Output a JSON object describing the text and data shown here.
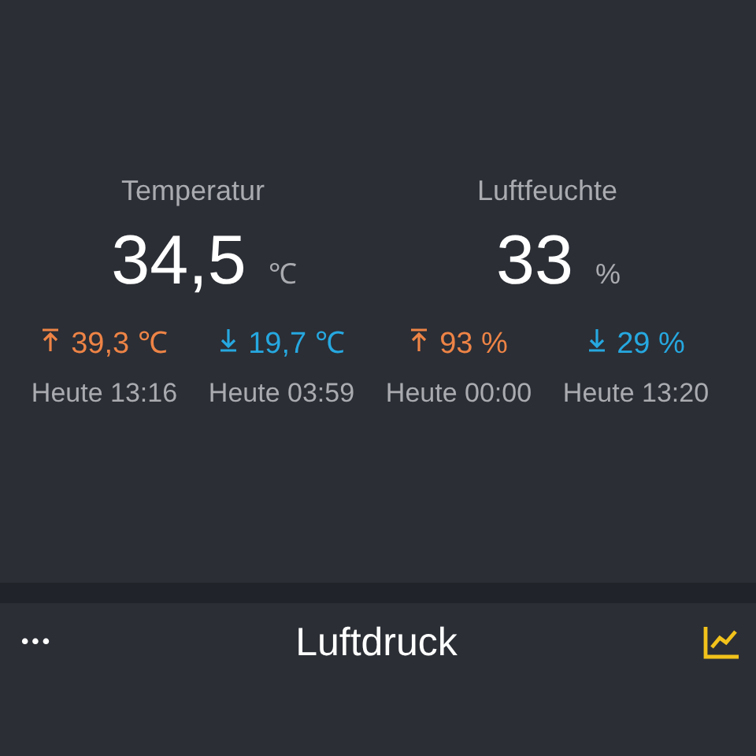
{
  "sensors": [
    {
      "title": "Temperatur",
      "value": "34,5",
      "unit": "℃",
      "extremes": [
        {
          "kind": "max",
          "value": "39,3 ℃",
          "time": "Heute 13:16"
        },
        {
          "kind": "min",
          "value": "19,7 ℃",
          "time": "Heute 03:59"
        }
      ]
    },
    {
      "title": "Luftfeuchte",
      "value": "33",
      "unit": "%",
      "extremes": [
        {
          "kind": "max",
          "value": "93 %",
          "time": "Heute 00:00"
        },
        {
          "kind": "min",
          "value": "29 %",
          "time": "Heute 13:20"
        }
      ]
    }
  ],
  "next_card": {
    "menu": "•••",
    "title": "Luftdruck"
  }
}
